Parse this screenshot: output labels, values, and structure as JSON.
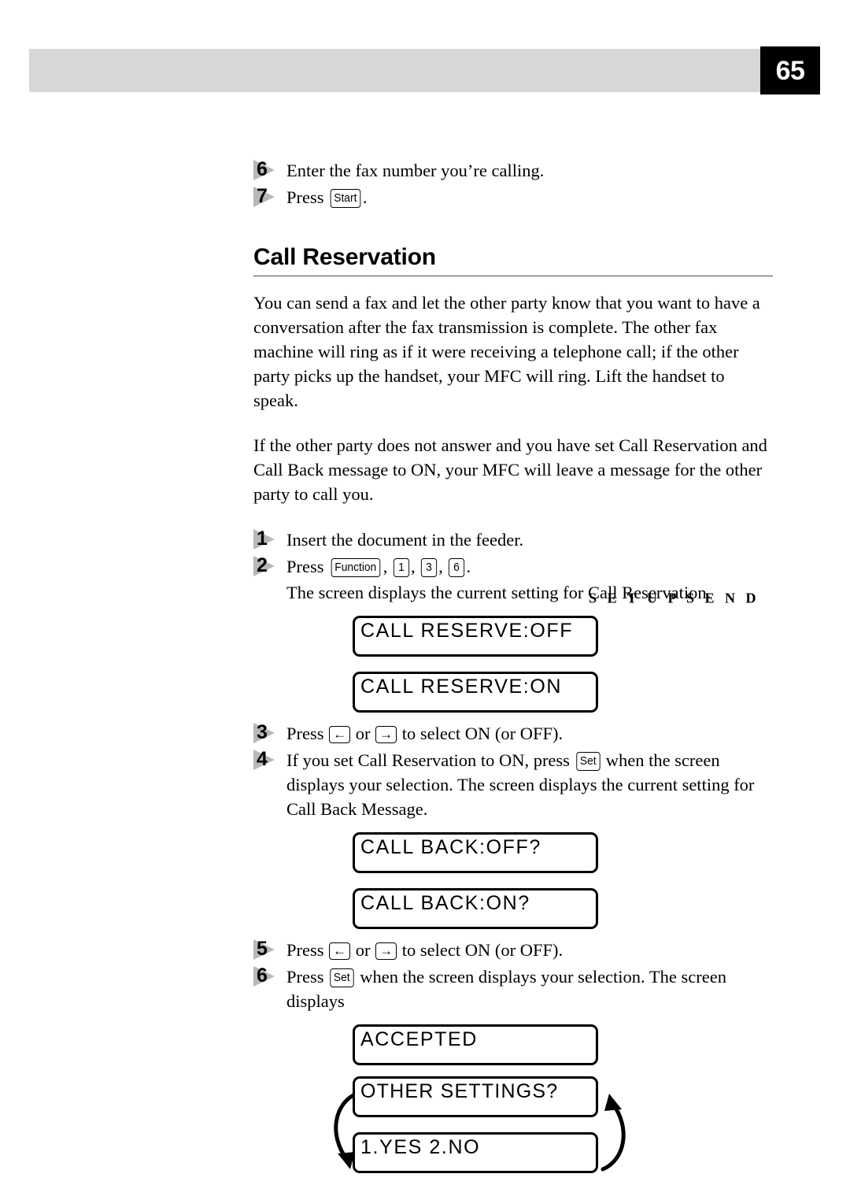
{
  "header": {
    "title": "S E T U P   S E N D",
    "page_number": "65"
  },
  "top_steps": [
    {
      "num": "6",
      "text": "Enter the fax number you’re calling."
    },
    {
      "num": "7",
      "text_before": "Press ",
      "key": "Start",
      "text_after": "."
    }
  ],
  "section": {
    "heading": "Call Reservation",
    "paragraphs": [
      "You can send a fax and let the other party know that you want to have a conversation after the fax transmission is complete. The other fax machine will ring as if it were receiving a telephone call; if the other party picks up the handset, your MFC will ring. Lift the handset to speak.",
      "If the other party does not answer and you have set Call Reservation and Call Back message to ON, your MFC will leave a message for the other party to call you."
    ]
  },
  "steps": {
    "s1": {
      "num": "1",
      "text": "Insert the document in the feeder."
    },
    "s2": {
      "num": "2",
      "text_before": "Press ",
      "key_function": "Function",
      "key_1": "1",
      "key_3": "3",
      "key_6": "6",
      "sub": "The screen displays the current setting for Call Reservation."
    },
    "s3": {
      "num": "3",
      "text_before": "Press ",
      "key_left": "←",
      "text_mid": " or ",
      "key_right": "→",
      "text_after": " to select ON (or OFF)."
    },
    "s4": {
      "num": "4",
      "text_before": "If you set Call Reservation to ON, press ",
      "key_set": "Set",
      "text_after": " when the screen displays your selection. The screen displays the current setting for Call Back Message."
    },
    "s5": {
      "num": "5",
      "text_before": "Press ",
      "key_left": "←",
      "text_mid": " or ",
      "key_right": "→",
      "text_after": " to select ON (or OFF)."
    },
    "s6": {
      "num": "6",
      "text_before": "Press ",
      "key_set": "Set",
      "text_after": " when the screen displays your selection. The screen displays"
    }
  },
  "lcd_displays": {
    "reserve_off": "CALL RESERVE:OFF",
    "reserve_on": "CALL RESERVE:ON",
    "back_off": "CALL BACK:OFF?",
    "back_on": "CALL BACK:ON?",
    "accepted": "ACCEPTED",
    "other_settings": "OTHER SETTINGS?",
    "yes_no": "1.YES 2.NO"
  },
  "colors": {
    "header_band": "#d7d7d7",
    "page_box": "#000000",
    "step_marker": "#b8b8b8",
    "rule": "#4a4a4a"
  }
}
